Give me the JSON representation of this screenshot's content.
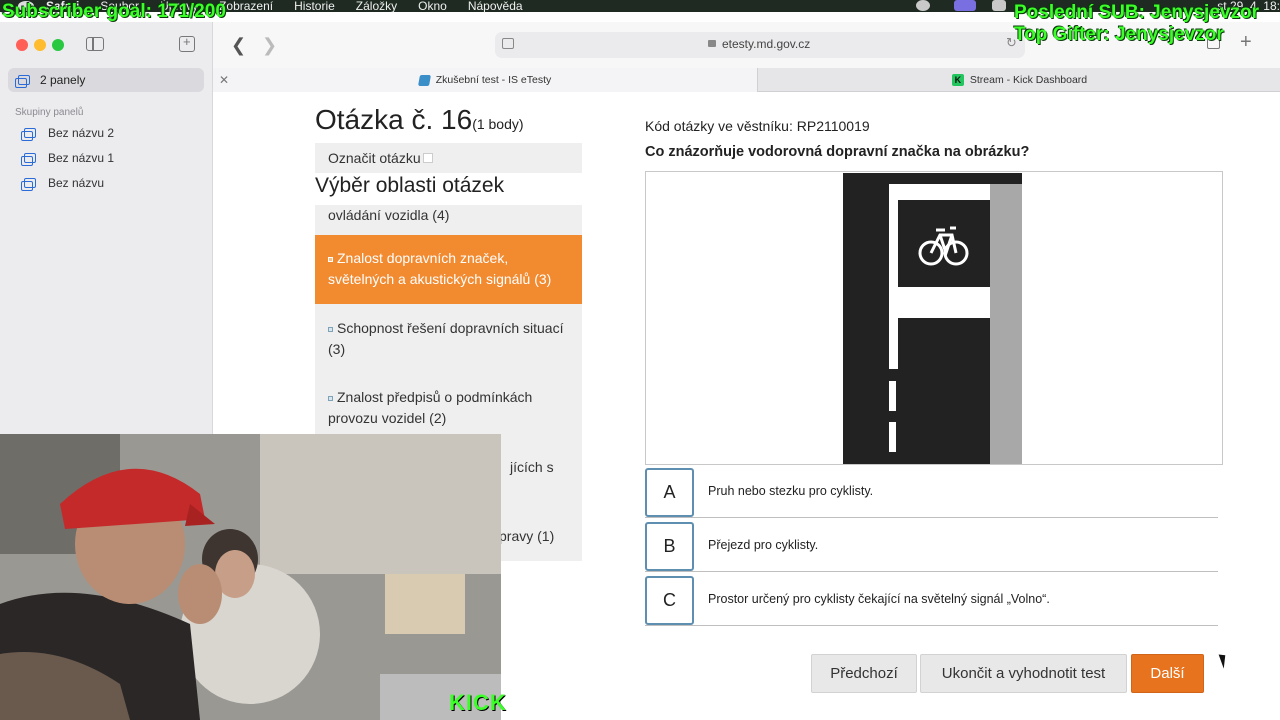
{
  "menubar": {
    "items": [
      "Safari",
      "Soubor",
      "Úpravy",
      "Zobrazení",
      "Historie",
      "Záložky",
      "Okno",
      "Nápověda"
    ],
    "clock": "st 29. 4.  18:"
  },
  "overlay": {
    "subscriber_goal": "Subscriber goal: 171/200",
    "last_sub": "Poslední SUB: Jenysjevzor",
    "top_gifter": "Top Gifter: Jenysjevzor",
    "kick_logo": "KICK"
  },
  "sidebar": {
    "active_group": "2 panely",
    "section_label": "Skupiny panelů",
    "groups": [
      "Bez názvu 2",
      "Bez názvu 1",
      "Bez názvu"
    ]
  },
  "browser": {
    "url": "etesty.md.gov.cz",
    "tabs": [
      {
        "title": "Zkušební test - IS eTesty"
      },
      {
        "title": "Stream - Kick Dashboard"
      }
    ]
  },
  "page": {
    "question_title": "Otázka č. 16",
    "question_points": "(1 body)",
    "mark_label": "Označit otázku",
    "area_heading": "Výběr oblasti otázek",
    "areas": [
      "ovládání vozidla (4)",
      "Znalost dopravních značek, světelných a akustických signálů (3)",
      "Schopnost řešení dopravních situací (3)",
      "Znalost předpisů o podmínkách provozu vozidel (2)",
      "jících s",
      "pravy (1)"
    ],
    "active_area_index": 1,
    "question_code": "Kód otázky ve věstníku: RP2110019",
    "question_text": "Co znázorňuje vodorovná dopravní značka na obrázku?",
    "answers": [
      {
        "letter": "A",
        "text": "Pruh nebo stezku pro cyklisty."
      },
      {
        "letter": "B",
        "text": "Přejezd pro cyklisty."
      },
      {
        "letter": "C",
        "text": "Prostor určený pro cyklisty čekající na světelný signál „Volno“."
      }
    ],
    "buttons": {
      "previous": "Předchozí",
      "finish": "Ukončit a vyhodnotit test",
      "next": "Další"
    }
  },
  "colors": {
    "accent_orange": "#f28a30",
    "next_button": "#e8731f",
    "overlay_green": "#3cff2a"
  }
}
